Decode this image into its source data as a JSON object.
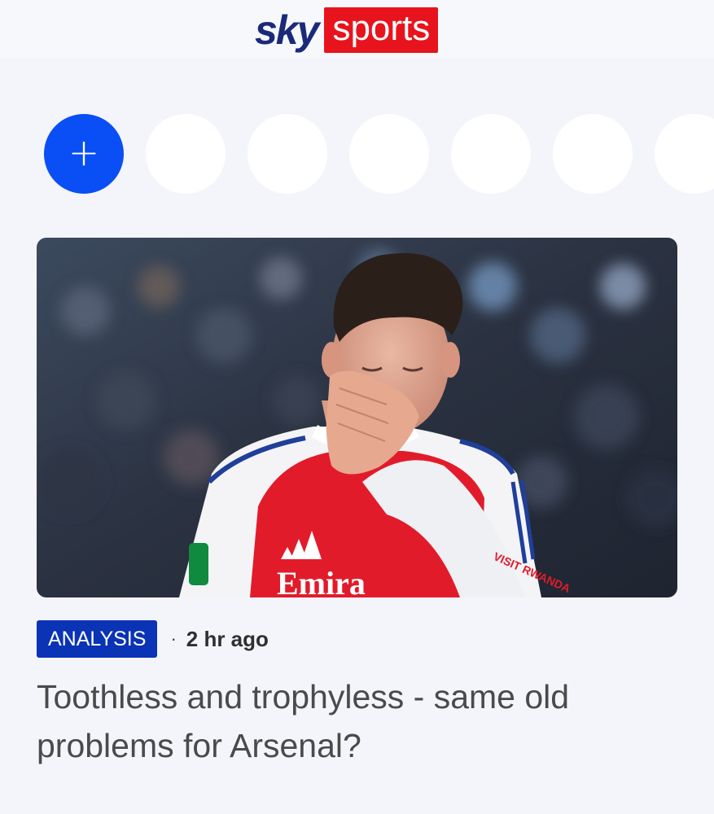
{
  "brand": {
    "logo_sky": "sky",
    "logo_sports": "sports",
    "primary_color": "#0a4ef5",
    "red": "#e8141d",
    "navy": "#1b2a78"
  },
  "stories": {
    "add_label": "+",
    "add_icon": "plus-icon",
    "count_placeholders": 6
  },
  "article": {
    "tag": "ANALYSIS",
    "separator": "·",
    "time": "2 hr ago",
    "headline": "Toothless and trophyless - same old problems for Arsenal?",
    "tag_color": "#0b33b5",
    "image": {
      "shirt_sponsor": "Emira",
      "sleeve_text": "VISIT RWANDA"
    }
  }
}
